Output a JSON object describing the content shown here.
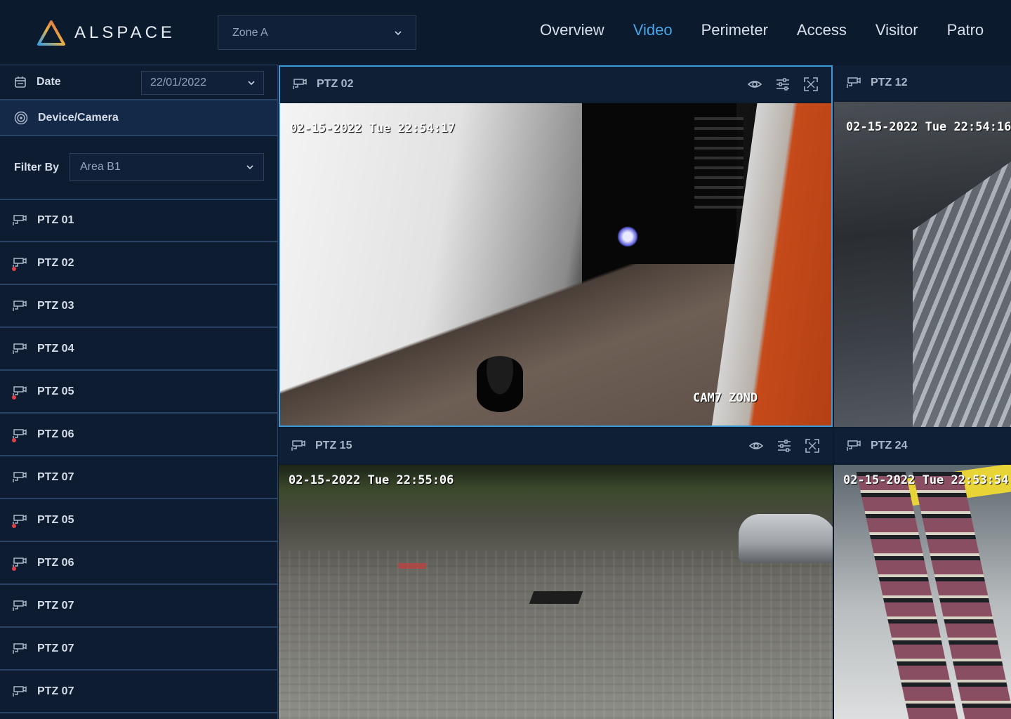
{
  "header": {
    "brand": "ALSPACE",
    "zone": "Zone A",
    "nav": [
      {
        "label": "Overview",
        "active": false
      },
      {
        "label": "Video",
        "active": true
      },
      {
        "label": "Perimeter",
        "active": false
      },
      {
        "label": "Access",
        "active": false
      },
      {
        "label": "Visitor",
        "active": false
      },
      {
        "label": "Patro",
        "active": false
      }
    ]
  },
  "sidebar": {
    "date_label": "Date",
    "date_value": "22/01/2022",
    "device_label": "Device/Camera",
    "filter_label": "Filter By",
    "filter_value": "Area B1",
    "cameras": [
      {
        "name": "PTZ 01",
        "alert": false
      },
      {
        "name": "PTZ 02",
        "alert": true
      },
      {
        "name": "PTZ 03",
        "alert": false
      },
      {
        "name": "PTZ 04",
        "alert": false
      },
      {
        "name": "PTZ 05",
        "alert": true
      },
      {
        "name": "PTZ 06",
        "alert": true
      },
      {
        "name": "PTZ 07",
        "alert": false
      },
      {
        "name": "PTZ 05",
        "alert": true
      },
      {
        "name": "PTZ 06",
        "alert": true
      },
      {
        "name": "PTZ 07",
        "alert": false
      },
      {
        "name": "PTZ 07",
        "alert": false
      },
      {
        "name": "PTZ 07",
        "alert": false
      }
    ]
  },
  "tiles": [
    {
      "title": "PTZ 02",
      "timestamp": "02-15-2022 Tue 22:54:17",
      "caption": "CAM7 ZOND",
      "selected": true
    },
    {
      "title": "PTZ 12",
      "timestamp": "02-15-2022 Tue 22:54:16"
    },
    {
      "title": "PTZ 15",
      "timestamp": "02-15-2022 Tue 22:55:06"
    },
    {
      "title": "PTZ 24",
      "timestamp": "02-15-2022 Tue 22:53:54"
    }
  ],
  "colors": {
    "background": "#0c1a2e",
    "accent": "#4aa6e8",
    "alert": "#e0404a",
    "border": "#2a4468"
  },
  "icons": {
    "calendar": "calendar-icon",
    "device": "target-icon",
    "camera": "cctv-camera-icon",
    "view": "eye-icon",
    "settings": "sliders-icon",
    "expand": "fullscreen-icon",
    "dropdown": "chevron-down-icon"
  }
}
